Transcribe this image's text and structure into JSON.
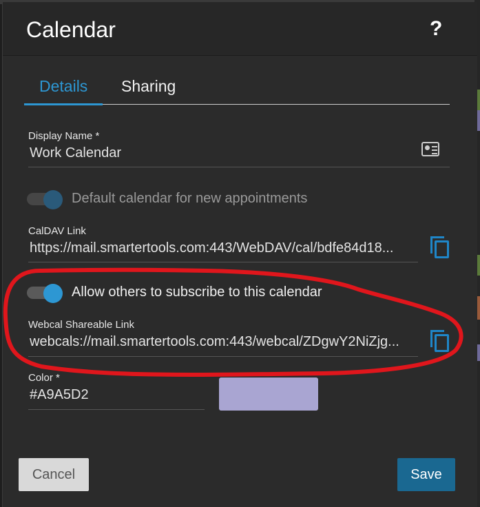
{
  "dialog": {
    "title": "Calendar",
    "help": "?"
  },
  "tabs": [
    {
      "label": "Details",
      "active": true
    },
    {
      "label": "Sharing",
      "active": false
    }
  ],
  "display_name": {
    "label": "Display Name *",
    "value": "Work Calendar"
  },
  "default_calendar": {
    "label": "Default calendar for new appointments",
    "checked": true,
    "disabled": true
  },
  "caldav": {
    "label": "CalDAV Link",
    "value": "https://mail.smartertools.com:443/WebDAV/cal/bdfe84d18..."
  },
  "subscribe": {
    "label": "Allow others to subscribe to this calendar",
    "checked": true
  },
  "webcal": {
    "label": "Webcal Shareable Link",
    "value": "webcals://mail.smartertools.com:443/webcal/ZDgwY2NiZjg..."
  },
  "color": {
    "label": "Color *",
    "value": "#A9A5D2",
    "swatch": "#A9A5D2"
  },
  "buttons": {
    "cancel": "Cancel",
    "save": "Save"
  },
  "theme": {
    "accent": "#2d97d3",
    "annotation": "#e0161c"
  }
}
